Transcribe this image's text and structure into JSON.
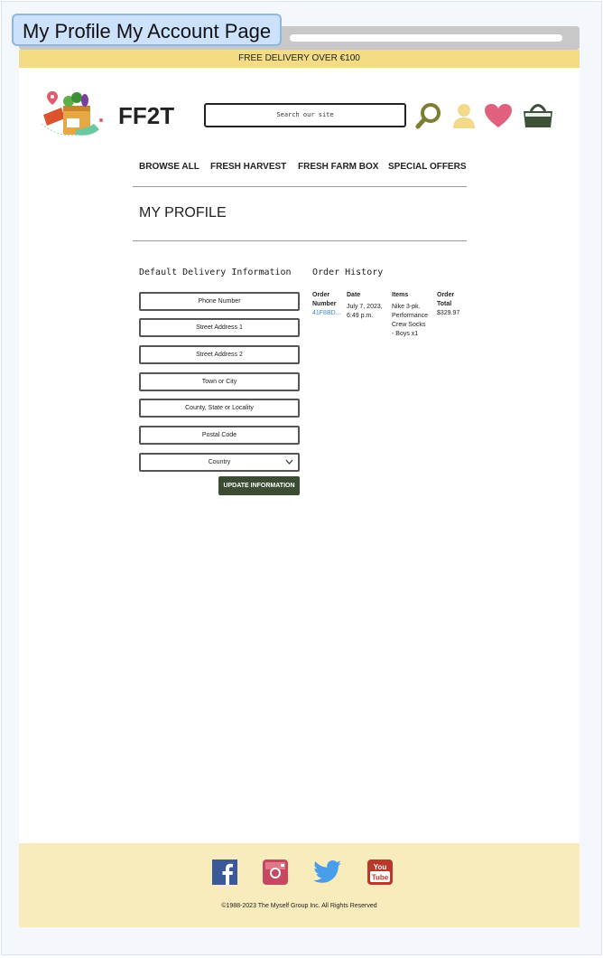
{
  "window": {
    "page_title": "My Profile My Account Page"
  },
  "promo": {
    "text": "FREE DELIVERY OVER €100"
  },
  "header": {
    "brand": "FF2T",
    "search_placeholder": "Search our site",
    "icons": [
      "search-icon",
      "user-icon",
      "heart-icon",
      "cart-icon"
    ]
  },
  "nav": {
    "items": [
      {
        "label": "BROWSE ALL"
      },
      {
        "label": "FRESH HARVEST"
      },
      {
        "label": "FRESH FARM BOX"
      },
      {
        "label": "SPECIAL OFFERS"
      }
    ]
  },
  "profile": {
    "heading": "MY PROFILE"
  },
  "delivery": {
    "heading": "Default Delivery Information",
    "fields": [
      {
        "placeholder": "Phone Number"
      },
      {
        "placeholder": "Street Address 1"
      },
      {
        "placeholder": "Street Address 2"
      },
      {
        "placeholder": "Town or City"
      },
      {
        "placeholder": "County, State or Locality"
      },
      {
        "placeholder": "Postal Code"
      }
    ],
    "country": {
      "selected": "Country"
    },
    "button": "UPDATE INFORMATION"
  },
  "order_history": {
    "heading": "Order History",
    "columns": {
      "number": [
        "Order",
        "Number"
      ],
      "date": "Date",
      "items": "Items",
      "total": [
        "Order",
        "Total"
      ]
    },
    "rows": [
      {
        "number": "41F8BD...",
        "date": [
          "July 7, 2023,",
          "6:49 p.m."
        ],
        "items": [
          "Nike 3-pk.",
          "Performance",
          "Crew Socks",
          "- Boys x1"
        ],
        "total": "$329.97"
      }
    ]
  },
  "footer": {
    "social": [
      "facebook-icon",
      "instagram-icon",
      "twitter-icon",
      "youtube-icon"
    ],
    "youtube_logo_text": [
      "You",
      "Tube"
    ],
    "copyright": "©1988-2023 The Myself Group Inc. All Rights Reserved"
  },
  "colors": {
    "promo_bg": "#f4dc84",
    "footer_bg": "#f9ecbc",
    "button_bg": "#3b4c32",
    "search_icon": "#7d7d33",
    "user_icon": "#f3d98a",
    "heart_icon": "#e0607e",
    "cart_icon": "#3d5138",
    "link": "#3a86d6"
  }
}
